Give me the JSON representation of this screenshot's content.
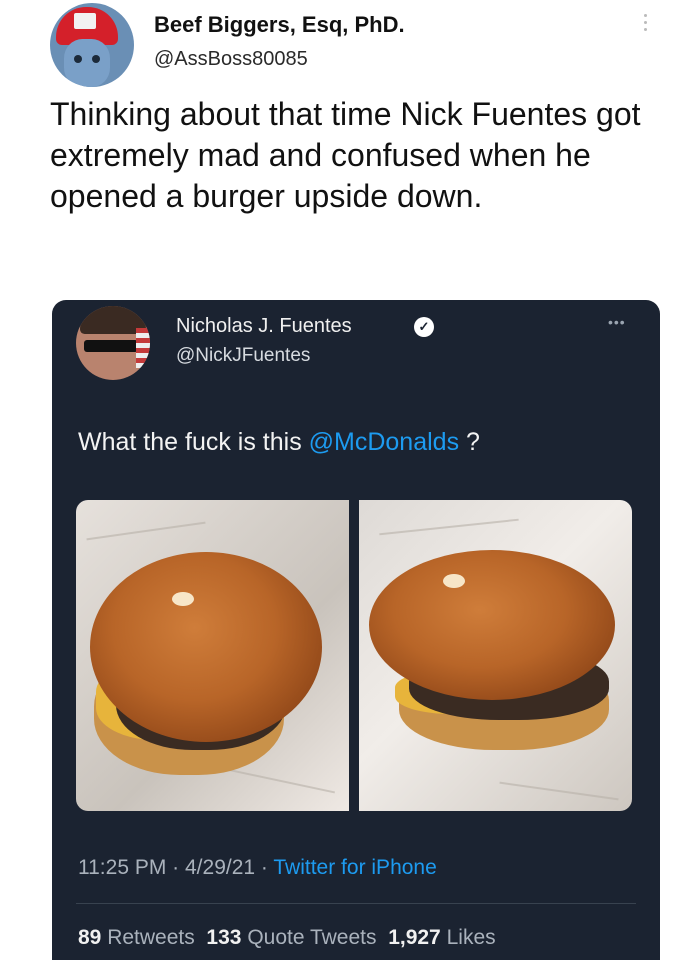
{
  "outer_tweet": {
    "display_name": "Beef Biggers, Esq, PhD.",
    "handle": "@AssBoss80085",
    "text": "Thinking about that time Nick Fuentes got extremely mad and confused when he opened a burger upside down."
  },
  "quoted_tweet": {
    "display_name": "Nicholas J. Fuentes",
    "handle": "@NickJFuentes",
    "text_before": "What the fuck is this ",
    "mention": "@McDonalds",
    "text_after": " ?",
    "time": "11:25 PM",
    "date": "4/29/21",
    "source": "Twitter for iPhone",
    "retweets_count": "89",
    "retweets_label": "Retweets",
    "quote_count": "133",
    "quote_label": "Quote Tweets",
    "likes_count": "1,927",
    "likes_label": "Likes"
  },
  "colors": {
    "card_background": "#1b2331",
    "link_blue": "#1d9bf0",
    "muted_text": "#aab2bc"
  },
  "icons": [
    "more-vertical-icon",
    "more-horizontal-icon",
    "verified-badge-icon"
  ]
}
